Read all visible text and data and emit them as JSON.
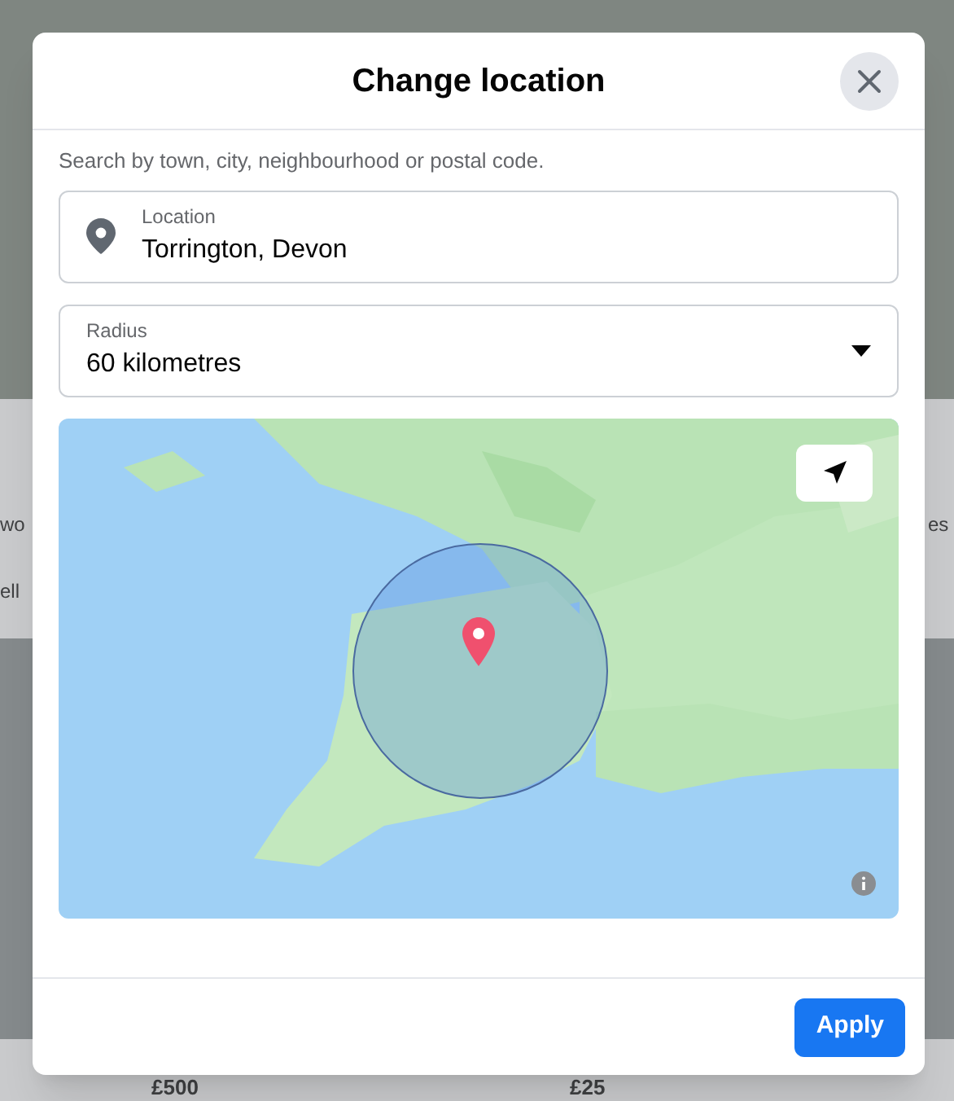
{
  "background": {
    "fragments": [
      "wo",
      "ell",
      "es"
    ],
    "prices": [
      "£500",
      "£25"
    ]
  },
  "dialog": {
    "title": "Change location",
    "hint": "Search by town, city, neighbourhood or postal code.",
    "location_field": {
      "label": "Location",
      "value": "Torrington, Devon"
    },
    "radius_field": {
      "label": "Radius",
      "value": "60 kilometres"
    },
    "map": {
      "kind": "picture"
    },
    "buttons": [
      "Apply"
    ]
  }
}
